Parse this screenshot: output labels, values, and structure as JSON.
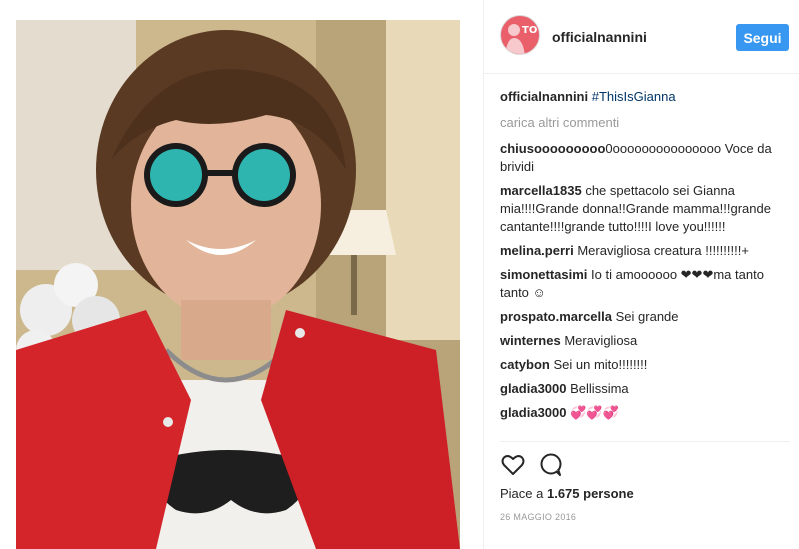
{
  "post": {
    "username": "officialnannini",
    "avatar_text": "TO",
    "follow_label": "Segui",
    "caption_user": "officialnannini",
    "caption_hashtag": "#ThisIsGianna",
    "load_more": "carica altri commenti",
    "comments": [
      {
        "user": "chiusooooooooo",
        "text": "0ooooooooooooooo Voce da brividi"
      },
      {
        "user": "marcella1835",
        "text": "che spettacolo sei Gianna mia!!!!Grande donna!!Grande mamma!!!grande cantante!!!!grande tutto!!!!I love you!!!!!!"
      },
      {
        "user": "melina.perri",
        "text": "Meravigliosa creatura !!!!!!!!!!+"
      },
      {
        "user": "simonettasimi",
        "text": "Io ti amoooooo ❤❤❤ma tanto tanto ☺"
      },
      {
        "user": "prospato.marcella",
        "text": "Sei grande"
      },
      {
        "user": "winternes",
        "text": "Meravigliosa"
      },
      {
        "user": "catybon",
        "text": "Sei un mito!!!!!!!!"
      },
      {
        "user": "gladia3000",
        "text": "Bellissima"
      },
      {
        "user": "gladia3000",
        "text": "💞💞💞"
      }
    ],
    "likes_prefix": "Piace a ",
    "likes_count": "1.675 persone",
    "date": "26 MAGGIO 2016"
  },
  "icons": {
    "like": "heart-icon",
    "comment": "comment-bubble-icon"
  },
  "colors": {
    "follow_button": "#3897f0",
    "avatar_bg": "#e9606b",
    "jacket": "#d4252a"
  }
}
